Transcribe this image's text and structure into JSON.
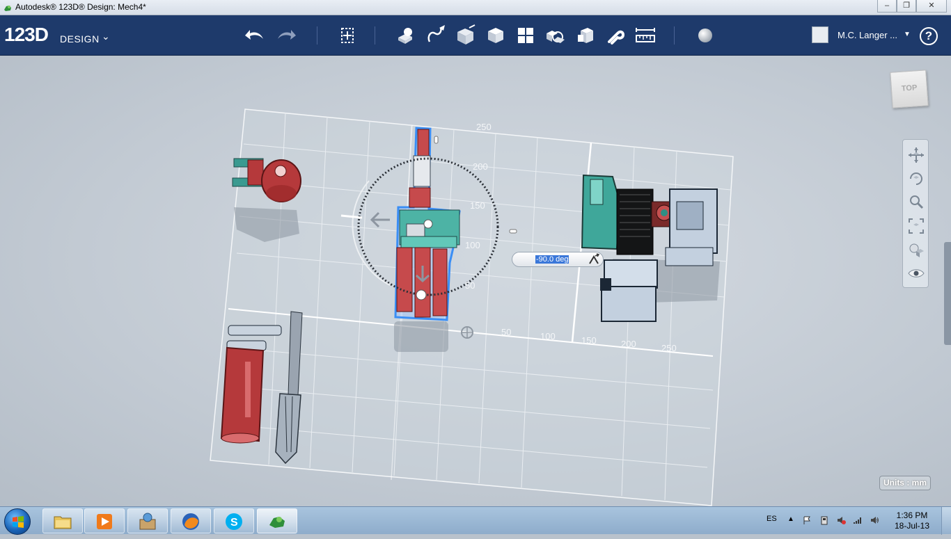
{
  "window": {
    "title": "Autodesk® 123D® Design: Mech4*",
    "minimize": "–",
    "maximize": "❐",
    "close": "✕"
  },
  "app": {
    "logo": "123D",
    "logo_sub": "DESIGN"
  },
  "toolbar": {
    "items": [
      "undo-icon",
      "redo-icon",
      "transform-icon",
      "primitives-icon",
      "sketch-icon",
      "construct-icon",
      "modify-icon",
      "pattern-icon",
      "grouping-icon",
      "combine-icon",
      "snap-icon",
      "measure-icon",
      "material-icon"
    ]
  },
  "user": {
    "name": "M.C. Langer ...",
    "help": "?"
  },
  "viewcube": {
    "label": "TOP"
  },
  "grid": {
    "labels_vertical": [
      "250",
      "200",
      "150",
      "100",
      "50"
    ],
    "labels_horizontal": [
      "50",
      "100",
      "150",
      "200",
      "250"
    ]
  },
  "rotate_input": {
    "value": "-90.0 deg"
  },
  "units": {
    "label": "Units : mm"
  },
  "taskbar": {
    "apps": [
      "explorer-icon",
      "media-player-icon",
      "store-icon",
      "firefox-icon",
      "skype-icon",
      "123d-design-icon"
    ],
    "language": "ES",
    "time": "1:36 PM",
    "date": "18-Jul-13"
  },
  "colors": {
    "toolbar_bg": "#1e3a6b",
    "selection": "#3a8ef5",
    "part_red": "#b5393b",
    "part_teal": "#3fa79a",
    "part_grey": "#b9c7d8"
  }
}
